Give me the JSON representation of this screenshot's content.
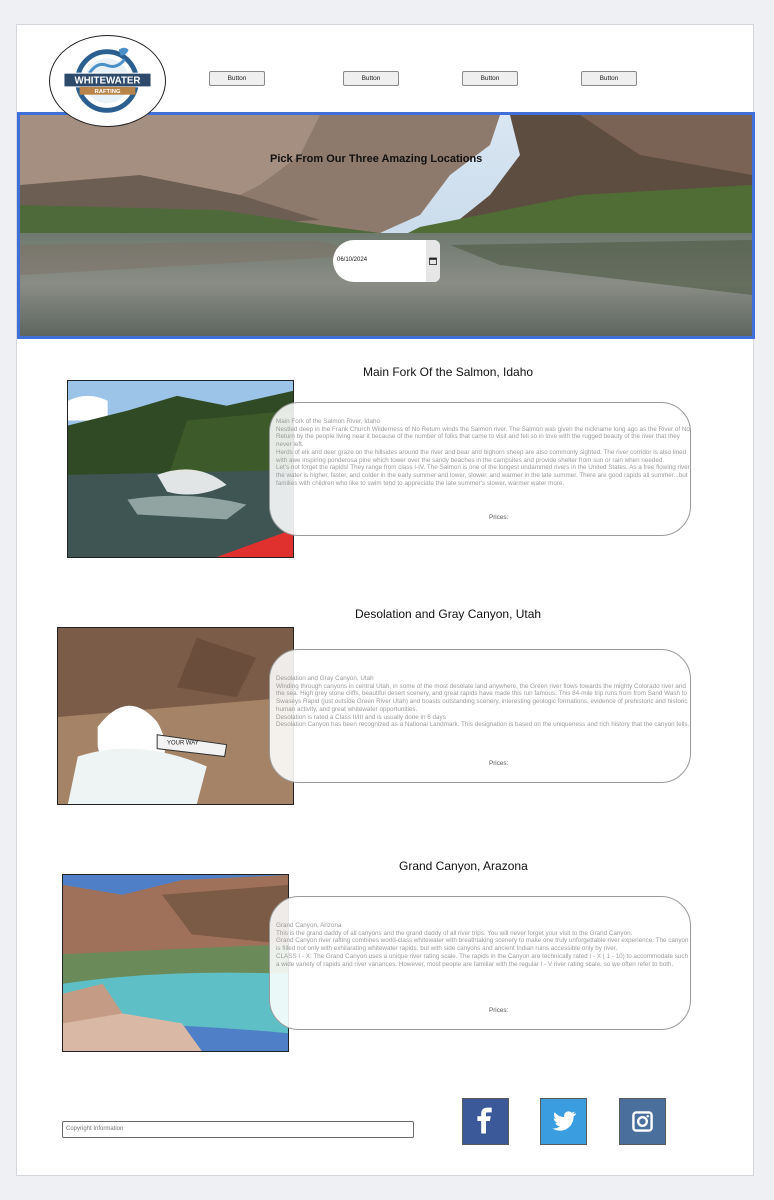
{
  "header": {
    "logo": {
      "line1": "WHITEWATER",
      "line2": "RAFTING"
    },
    "nav_buttons": [
      "Button",
      "Button",
      "Button",
      "Button"
    ]
  },
  "hero": {
    "title": "Pick From Our Three Amazing Locations",
    "date_value": "06/10/2024"
  },
  "locations": [
    {
      "title": "Main Fork Of the Salmon, Idaho",
      "description": [
        "Main Fork of the Salmon River, Idaho",
        "Nestled deep in the Frank Church Wilderness of No Return winds the Salmon river. The Salmon was given the nickname long ago as the River of No Return by the people living near it because of the number of folks that came to visit and fell so in love with the rugged beauty of the river that they never left.",
        "Herds of elk and deer graze on the hillsides around the river and bear and bighorn sheep are also commonly sighted. The river corridor is also lined with awe inspiring ponderosa pine which tower over the sandy beaches in the campsites and provide shelter from sun or rain when needed.",
        "Let's not forget the rapids! They range from class I-IV. The Salmon is one of the longest undammed rivers in the United States. As a free flowing river the water is higher, faster, and colder in the early summer and lower, slower, and warmer in the late summer. There are good rapids all summer...but families with children who like to swim tend to appreciate the late summer's slower, warmer water more."
      ],
      "prices_label": "Prices:"
    },
    {
      "title": "Desolation and Gray Canyon, Utah",
      "description": [
        "Desolation and Gray Canyon, Utah",
        "Winding through canyons in central Utah, in some of the most desolate land anywhere, the Green river flows towards the mighty Colorado river and the sea. High grey stone cliffs, beautiful desert scenery, and great rapids have made this run famous. This 84-mile trip runs from from Sand Wash to Swaseys Rapid (just outside Green River Utah) and boasts outstanding scenery, interesting geologic formations, evidence of prehistoric and historic human activity, and great whitewater opportunities.",
        "Desolation is rated a Class II/III and is usually done in 6 days",
        "Desolation Canyon has been recognized as a National Landmark.  This designation is based on the uniqueness and rich history that the canyon tells."
      ],
      "prices_label": "Prices:"
    },
    {
      "title": "Grand Canyon, Arazona",
      "description": [
        "Grand Canyon, Arizona",
        "This is the grand daddy of all canyons and the grand daddy of all river trips. You will never forget your visit to the Grand Canyon.",
        "Grand Canyon river rafting combines world-class whitewater with breathtaking scenery to make one truly unforgettable river experience. The canyon is filled not only with exhilarating whitewater rapids, but with side canyons and ancient Indian ruins accessible only by river.",
        "CLASS I - X: The Grand Canyon uses a unique river rating scale. The rapids in the Canyon are technically rated I - X ( 1 - 10) to accommodate such a wide variety of rapids and river variances. However, most people are familiar with the regular I - V river rating scale, so we often refer to both."
      ],
      "prices_label": "Prices:"
    }
  ],
  "raft_label": "YOUR WAY",
  "footer": {
    "copyright_placeholder": "Copyright Information",
    "social": [
      {
        "icon": "facebook-icon",
        "color": "#3b5998"
      },
      {
        "icon": "twitter-icon",
        "color": "#3a9de0"
      },
      {
        "icon": "instagram-icon",
        "color": "#4a6f9c"
      }
    ]
  }
}
